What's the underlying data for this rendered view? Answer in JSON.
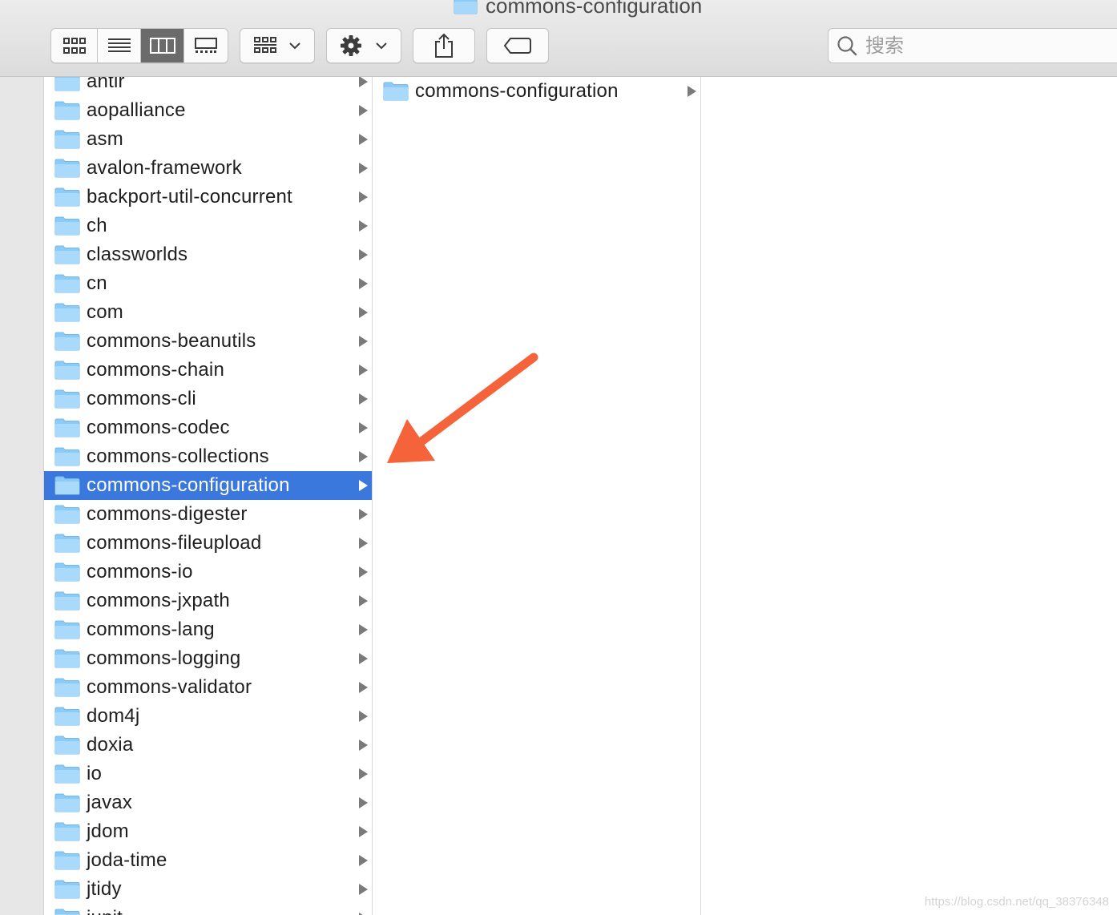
{
  "window": {
    "title": "commons-configuration"
  },
  "toolbar": {
    "view_modes": [
      {
        "name": "icon-view",
        "icon": "grid-icon",
        "active": false
      },
      {
        "name": "list-view",
        "icon": "list-icon",
        "active": false
      },
      {
        "name": "column-view",
        "icon": "columns-icon",
        "active": true
      },
      {
        "name": "gallery-view",
        "icon": "gallery-icon",
        "active": false
      }
    ],
    "group_icon": "group-grid-icon",
    "action_icon": "gear-icon",
    "share_icon": "share-icon",
    "tag_icon": "tag-icon",
    "search": {
      "placeholder": "搜索",
      "value": ""
    }
  },
  "columns": {
    "first": {
      "items": [
        {
          "label": "antlr",
          "selected": false
        },
        {
          "label": "aopalliance",
          "selected": false
        },
        {
          "label": "asm",
          "selected": false
        },
        {
          "label": "avalon-framework",
          "selected": false
        },
        {
          "label": "backport-util-concurrent",
          "selected": false
        },
        {
          "label": "ch",
          "selected": false
        },
        {
          "label": "classworlds",
          "selected": false
        },
        {
          "label": "cn",
          "selected": false
        },
        {
          "label": "com",
          "selected": false
        },
        {
          "label": "commons-beanutils",
          "selected": false
        },
        {
          "label": "commons-chain",
          "selected": false
        },
        {
          "label": "commons-cli",
          "selected": false
        },
        {
          "label": "commons-codec",
          "selected": false
        },
        {
          "label": "commons-collections",
          "selected": false
        },
        {
          "label": "commons-configuration",
          "selected": true
        },
        {
          "label": "commons-digester",
          "selected": false
        },
        {
          "label": "commons-fileupload",
          "selected": false
        },
        {
          "label": "commons-io",
          "selected": false
        },
        {
          "label": "commons-jxpath",
          "selected": false
        },
        {
          "label": "commons-lang",
          "selected": false
        },
        {
          "label": "commons-logging",
          "selected": false
        },
        {
          "label": "commons-validator",
          "selected": false
        },
        {
          "label": "dom4j",
          "selected": false
        },
        {
          "label": "doxia",
          "selected": false
        },
        {
          "label": "io",
          "selected": false
        },
        {
          "label": "javax",
          "selected": false
        },
        {
          "label": "jdom",
          "selected": false
        },
        {
          "label": "joda-time",
          "selected": false
        },
        {
          "label": "jtidy",
          "selected": false
        },
        {
          "label": "junit",
          "selected": false
        }
      ]
    },
    "second": {
      "items": [
        {
          "label": "commons-configuration",
          "selected": false
        }
      ]
    }
  },
  "colors": {
    "selection": "#3b78de",
    "folder": "#8ccbf7",
    "arrow": "#f4633a"
  },
  "watermark": "https://blog.csdn.net/qq_38376348"
}
